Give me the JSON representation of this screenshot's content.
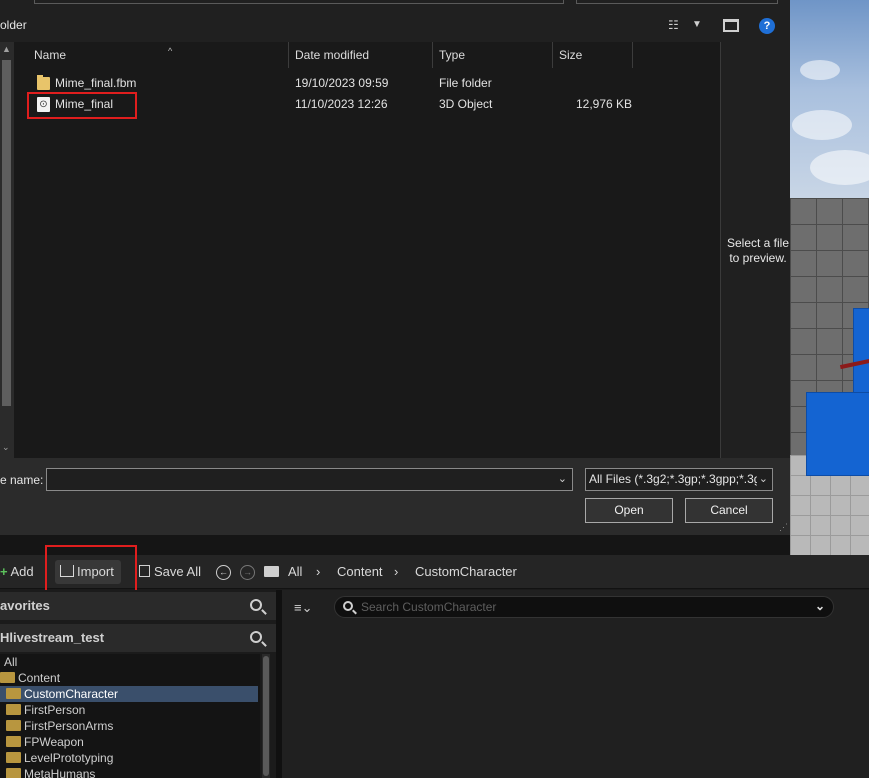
{
  "dialog": {
    "folder_label": "older",
    "columns": [
      {
        "label": "Name"
      },
      {
        "label": "Date modified"
      },
      {
        "label": "Type"
      },
      {
        "label": "Size"
      }
    ],
    "files": [
      {
        "name": "Mime_final.fbm",
        "date": "19/10/2023 09:59",
        "type": "File folder",
        "size": "",
        "icon": "folder-icon"
      },
      {
        "name": "Mime_final",
        "date": "11/10/2023 12:26",
        "type": "3D Object",
        "size": "12,976 KB",
        "icon": "3d-object-icon"
      }
    ],
    "preview_text": "Select a file to preview.",
    "file_name_label": "e name:",
    "file_name_value": "",
    "filter_value": "All Files (*.3g2;*.3gp;*.3gpp;*.3g",
    "open_label": "Open",
    "cancel_label": "Cancel"
  },
  "content_browser": {
    "toolbar": {
      "add_label": "Add",
      "import_label": "Import",
      "save_all_label": "Save All",
      "path": [
        "All",
        "Content",
        "CustomCharacter"
      ]
    },
    "sidebar": {
      "favorites_label": "avorites",
      "project_label": "Hlivestream_test",
      "tree": [
        {
          "label": "All",
          "level": 0,
          "selected": false,
          "folder": false
        },
        {
          "label": "Content",
          "level": 1,
          "selected": false,
          "folder": true
        },
        {
          "label": "CustomCharacter",
          "level": 2,
          "selected": true,
          "folder": true
        },
        {
          "label": "FirstPerson",
          "level": 2,
          "selected": false,
          "folder": true
        },
        {
          "label": "FirstPersonArms",
          "level": 2,
          "selected": false,
          "folder": true
        },
        {
          "label": "FPWeapon",
          "level": 2,
          "selected": false,
          "folder": true
        },
        {
          "label": "LevelPrototyping",
          "level": 2,
          "selected": false,
          "folder": true
        },
        {
          "label": "MetaHumans",
          "level": 2,
          "selected": false,
          "folder": true
        }
      ]
    },
    "search_placeholder": "Search CustomCharacter"
  },
  "colors": {
    "highlight": "#e01e1e",
    "selection": "#3a4f6b",
    "help_blue": "#1f6fd6"
  }
}
